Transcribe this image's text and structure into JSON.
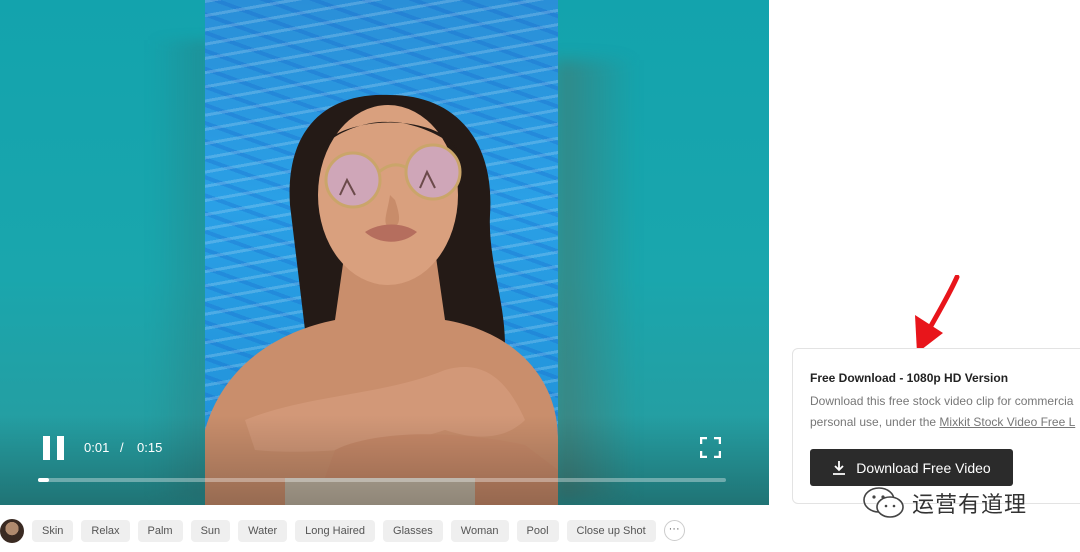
{
  "player": {
    "current_time": "0:01",
    "separator": "/",
    "duration": "0:15",
    "progress_fraction": 0.016,
    "pause_icon": "pause-icon",
    "fullscreen_icon": "fullscreen-icon"
  },
  "download_card": {
    "title": "Free Download - 1080p HD Version",
    "line1": "Download this free stock video clip for commercia",
    "line2_prefix": "personal use, under the ",
    "license_link": "Mixkit Stock Video Free L",
    "button_label": "Download Free Video",
    "button_icon": "download-icon"
  },
  "tags": [
    "Skin",
    "Relax",
    "Palm",
    "Sun",
    "Water",
    "Long Haired",
    "Glasses",
    "Woman",
    "Pool",
    "Close up Shot"
  ],
  "more_label": "···",
  "watermark": {
    "text": "运营有道理",
    "icon": "wechat-icon"
  },
  "colors": {
    "player_bg": "#1fa3aa",
    "button_bg": "#2b2b2b",
    "arrow": "#e8151b"
  }
}
